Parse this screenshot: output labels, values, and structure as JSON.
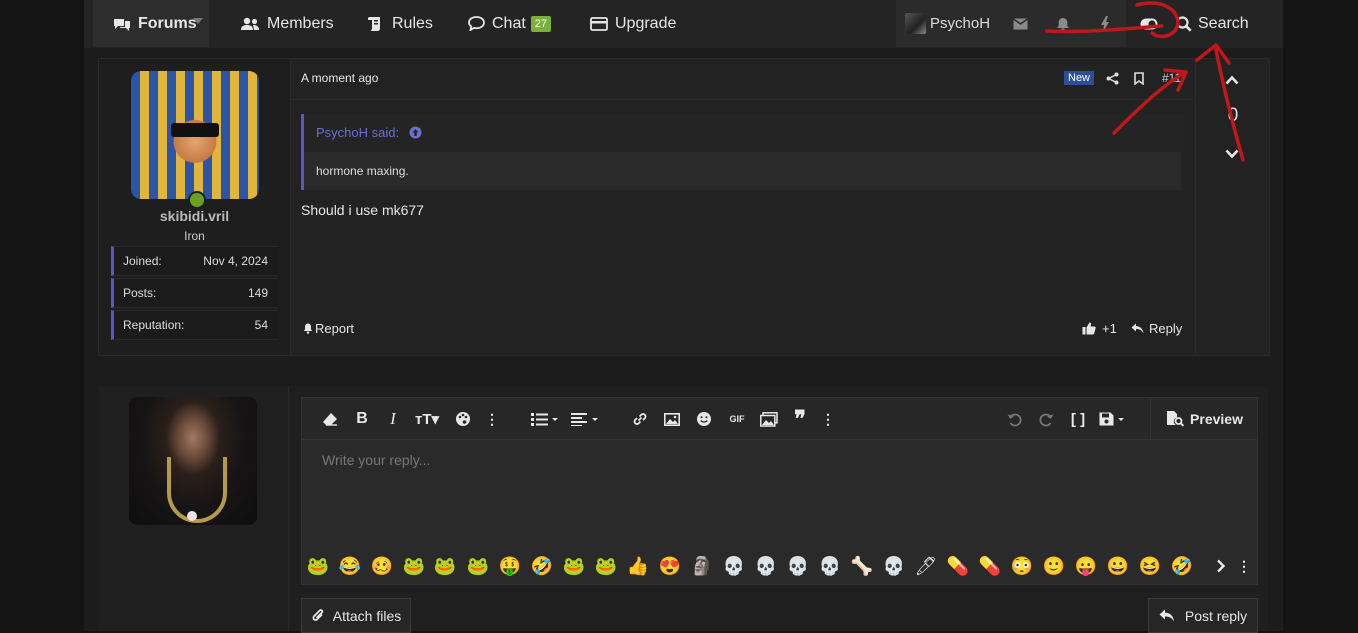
{
  "nav": {
    "forums": "Forums",
    "members": "Members",
    "rules": "Rules",
    "chat": "Chat",
    "chat_badge": "27",
    "upgrade": "Upgrade",
    "user": "PsychoH",
    "search": "Search"
  },
  "post": {
    "time": "A moment ago",
    "new_badge": "New",
    "number": "#11",
    "username": "skibidi.vril",
    "user_title": "Iron",
    "stats": [
      {
        "label": "Joined:",
        "value": "Nov 4, 2024"
      },
      {
        "label": "Posts:",
        "value": "149"
      },
      {
        "label": "Reputation:",
        "value": "54"
      }
    ],
    "quote_author": "PsychoH said:",
    "quote_text": "hormone maxing.",
    "message": "Should i use mk677",
    "report": "Report",
    "like": "+1",
    "reply": "Reply",
    "score": "0"
  },
  "editor": {
    "placeholder": "Write your reply...",
    "preview": "Preview",
    "emojis": [
      "🐸",
      "😂",
      "🥴",
      "🐸",
      "🐸",
      "🐸",
      "🤑",
      "🤣",
      "🐸",
      "🐸",
      "👍",
      "😍",
      "🗿",
      "💀",
      "💀",
      "💀",
      "💀",
      "🦴",
      "💀",
      "🖊",
      "💊",
      "💊",
      "😳",
      "🙂",
      "😛",
      "😀",
      "😆",
      "🤣"
    ]
  },
  "attach_files": "Attach files",
  "post_reply": "Post reply",
  "colors": {
    "accent": "#5a55c8",
    "badge_green": "#7bb13b",
    "annotation_red": "#c0171b"
  }
}
